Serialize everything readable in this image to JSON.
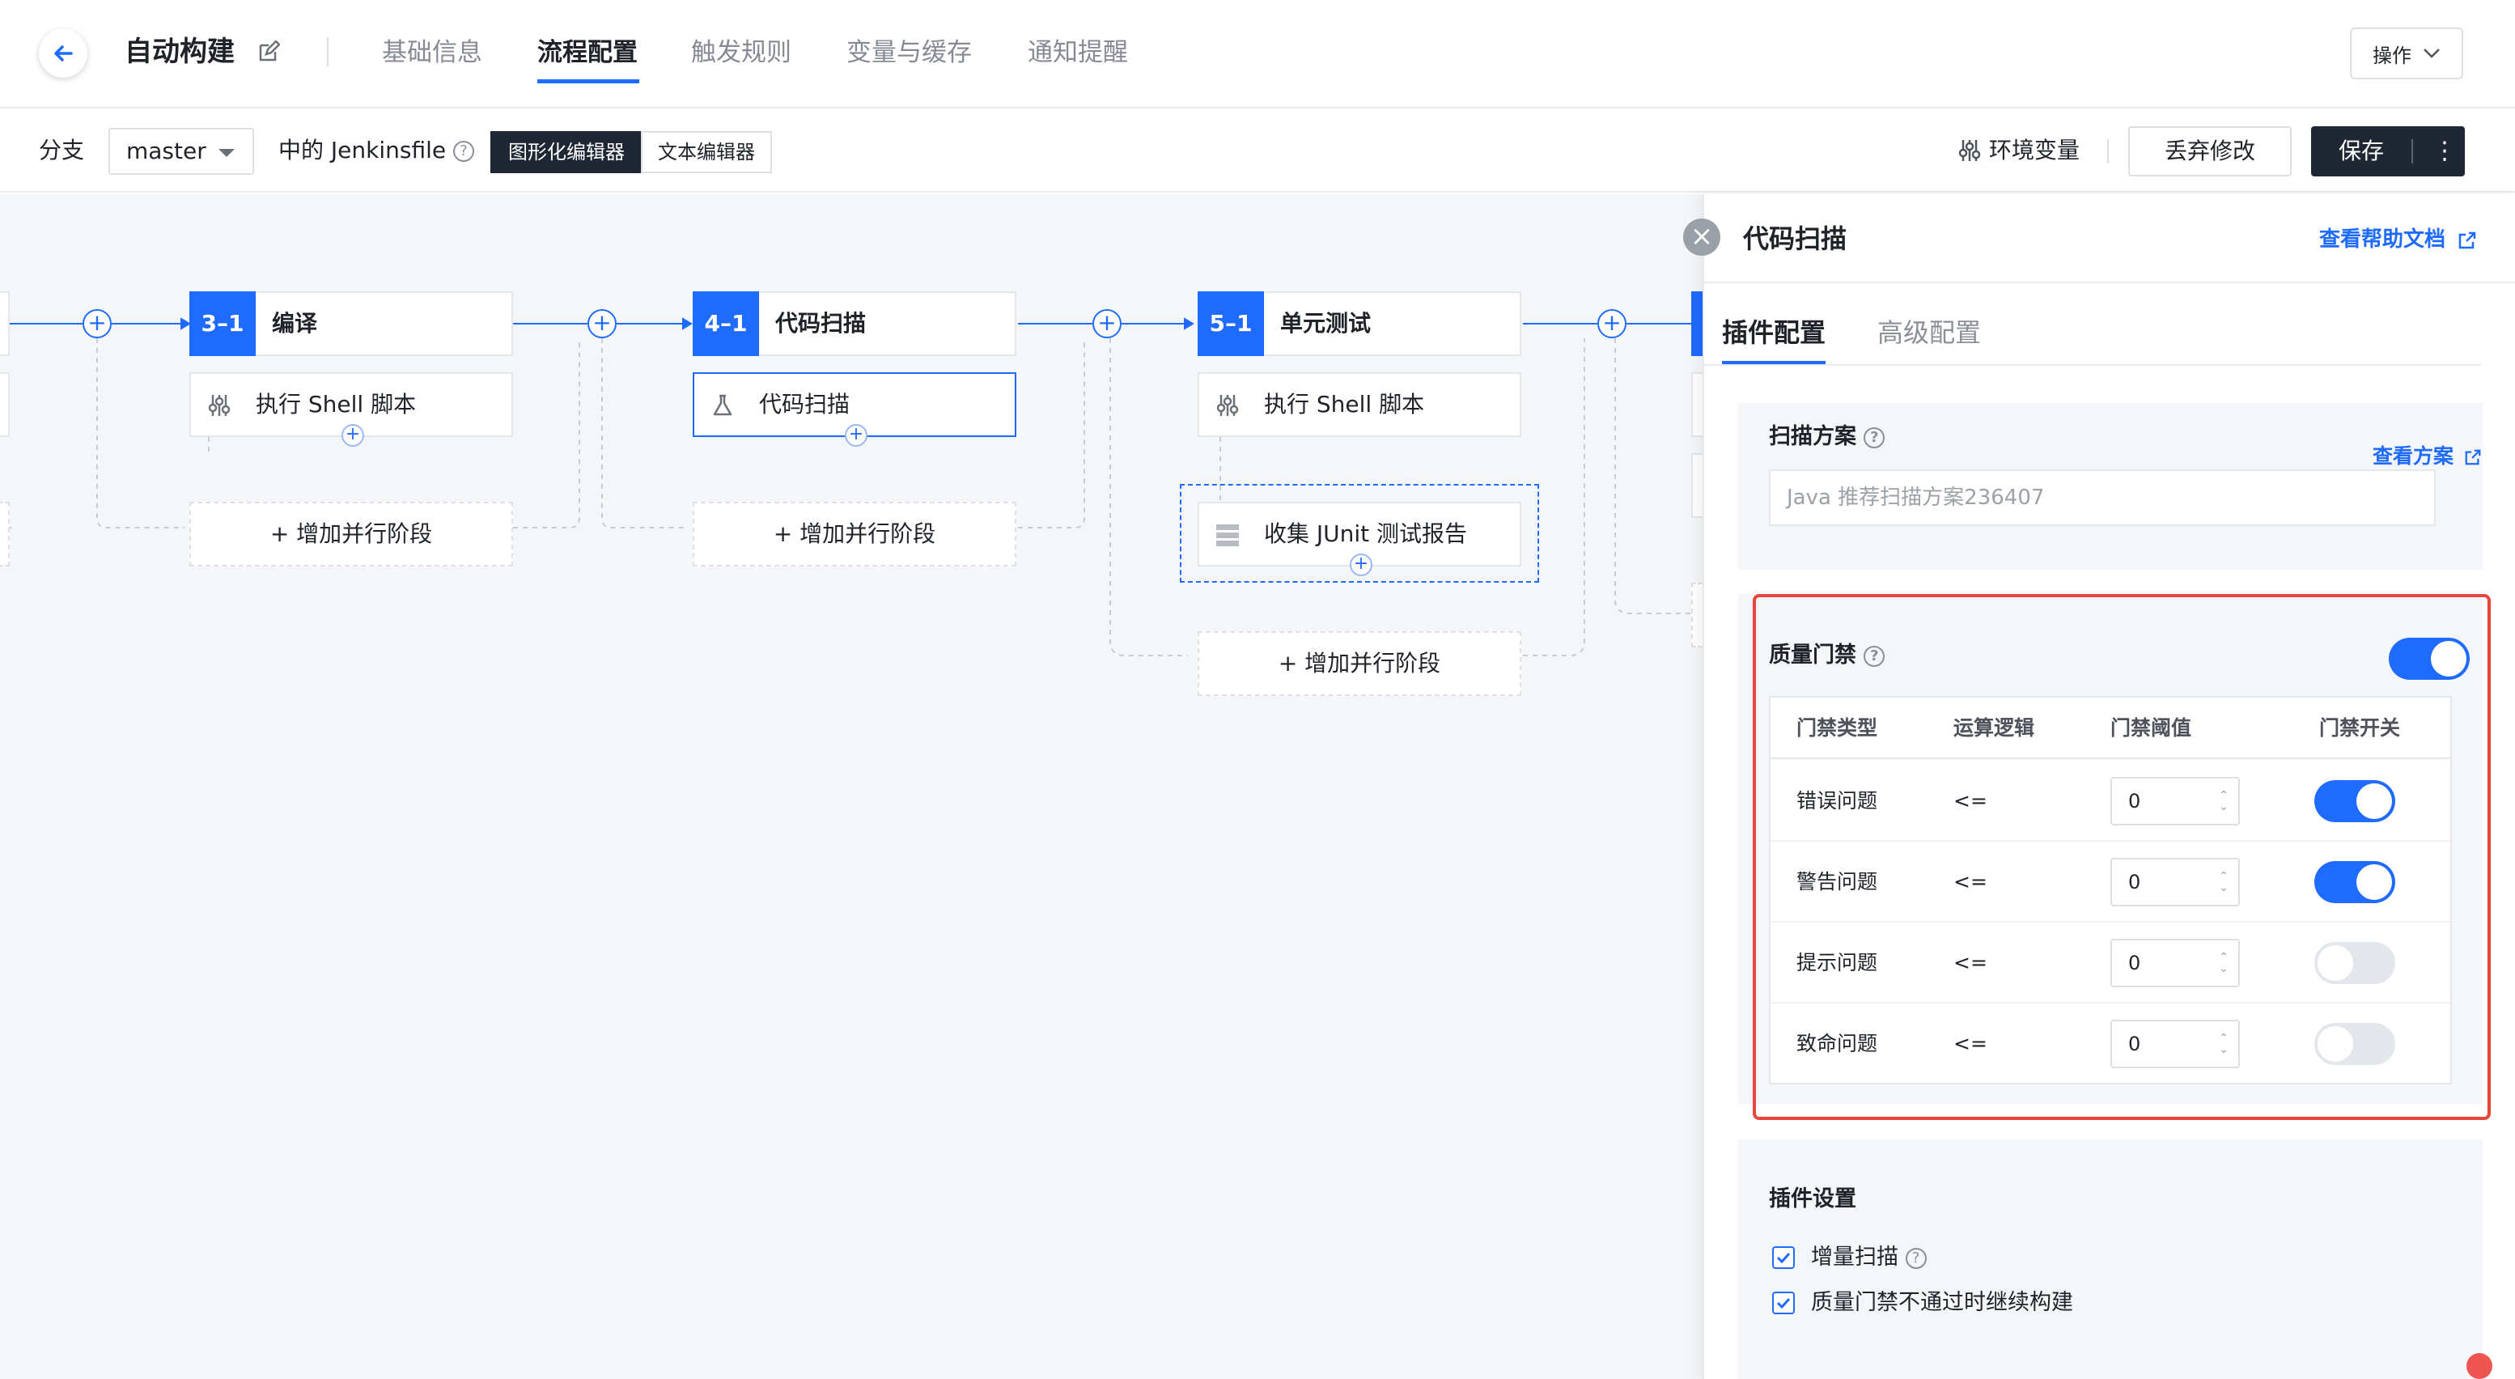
{
  "header": {
    "title": "自动构建",
    "tabs": [
      {
        "label": "基础信息"
      },
      {
        "label": "流程配置"
      },
      {
        "label": "触发规则"
      },
      {
        "label": "变量与缓存"
      },
      {
        "label": "通知提醒"
      }
    ],
    "operations_label": "操作"
  },
  "toolbar": {
    "branch_label": "分支",
    "branch_value": "master",
    "jenkinsfile_label": "中的 Jenkinsfile",
    "graphic_editor": "图形化编辑器",
    "text_editor": "文本编辑器",
    "env_vars": "环境变量",
    "discard": "丢弃修改",
    "save": "保存",
    "save_more": "⋮"
  },
  "pipeline": {
    "stages": [
      {
        "num": "3–1",
        "name": "编译",
        "task": "执行 Shell 脚本",
        "task_icon": "sliders-icon"
      },
      {
        "num": "4–1",
        "name": "代码扫描",
        "task": "代码扫描",
        "task_icon": "flask-icon"
      },
      {
        "num": "5–1",
        "name": "单元测试",
        "task": "执行 Shell 脚本",
        "task_icon": "sliders-icon",
        "extra_task": "收集 JUnit 测试报告"
      }
    ],
    "add_parallel": "+ 增加并行阶段",
    "add_symbol": "+"
  },
  "panel": {
    "close_symbol": "×",
    "title": "代码扫描",
    "help_doc": "查看帮助文档",
    "tabs": [
      {
        "label": "插件配置"
      },
      {
        "label": "高级配置"
      }
    ],
    "scan_plan": {
      "title": "扫描方案",
      "view_link": "查看方案",
      "value": "Java 推荐扫描方案236407"
    },
    "quality_gate": {
      "title": "质量门禁",
      "enabled": true,
      "columns": [
        "门禁类型",
        "运算逻辑",
        "门禁阈值",
        "门禁开关"
      ],
      "rows": [
        {
          "type": "错误问题",
          "op": "<=",
          "threshold": "0",
          "on": true
        },
        {
          "type": "警告问题",
          "op": "<=",
          "threshold": "0",
          "on": true
        },
        {
          "type": "提示问题",
          "op": "<=",
          "threshold": "0",
          "on": false
        },
        {
          "type": "致命问题",
          "op": "<=",
          "threshold": "0",
          "on": false
        }
      ]
    },
    "plugin_settings": {
      "title": "插件设置",
      "options": [
        {
          "label": "增量扫描",
          "checked": true,
          "help": true
        },
        {
          "label": "质量门禁不通过时继续构建",
          "checked": true,
          "help": false
        }
      ]
    }
  },
  "colors": {
    "accent": "#1f6bff",
    "dark": "#1f2735",
    "highlight_border": "#e8453c"
  }
}
